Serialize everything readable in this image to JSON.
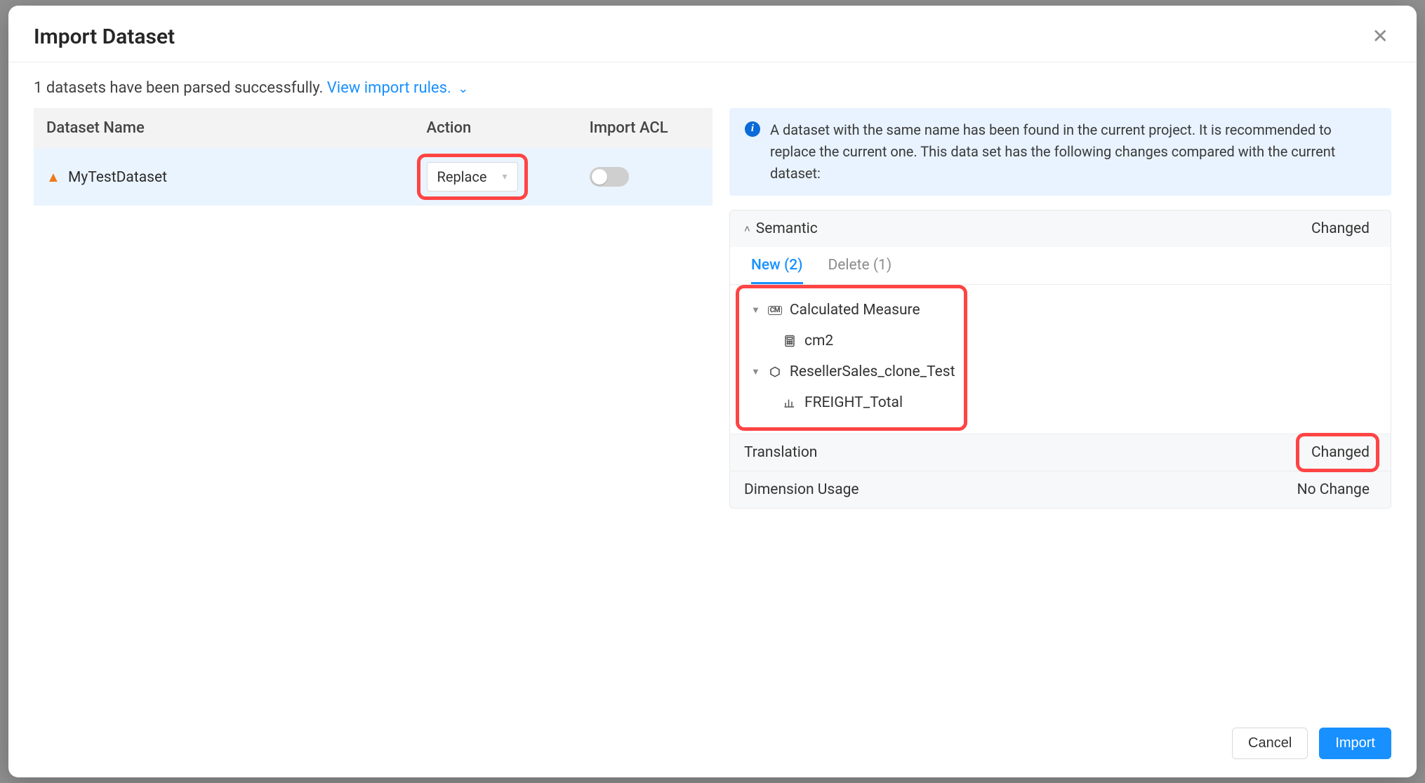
{
  "modal": {
    "title": "Import Dataset",
    "parsed_msg": "1 datasets have been parsed successfully. ",
    "view_rules": "View import rules."
  },
  "table": {
    "headers": {
      "name": "Dataset Name",
      "action": "Action",
      "acl": "Import ACL"
    },
    "row": {
      "name": "MyTestDataset",
      "action": "Replace"
    }
  },
  "info": {
    "text": "A dataset with the same name has been found in the current project. It is recommended to replace the current one. This data set has the following changes compared with the current dataset:"
  },
  "sections": {
    "semantic": {
      "label": "Semantic",
      "status": "Changed"
    },
    "translation": {
      "label": "Translation",
      "status": "Changed"
    },
    "dim_usage": {
      "label": "Dimension Usage",
      "status": "No Change"
    }
  },
  "tabs": {
    "new": "New (2)",
    "delete": "Delete (1)"
  },
  "tree": {
    "calc_measure": "Calculated Measure",
    "cm2": "cm2",
    "reseller": "ResellerSales_clone_Test",
    "freight": "FREIGHT_Total"
  },
  "footer": {
    "cancel": "Cancel",
    "import": "Import"
  }
}
